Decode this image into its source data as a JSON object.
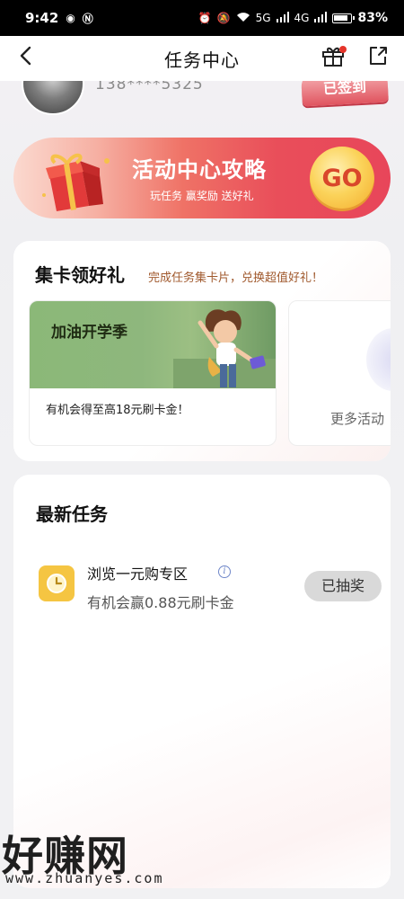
{
  "status_bar": {
    "time": "9:42",
    "network_5g": "5G",
    "network_4g": "4G",
    "battery": "83%"
  },
  "nav": {
    "title": "任务中心",
    "back_icon": "chevron-left-icon",
    "gift_icon": "gift-icon",
    "share_icon": "share-icon",
    "accent_dot_color": "#e5342a"
  },
  "user": {
    "phone_masked": "138****5325",
    "signed_badge": "已签到"
  },
  "strategy_banner": {
    "title": "活动中心攻略",
    "subtitle": "玩任务 赢奖励 送好礼",
    "go_label": "GO"
  },
  "card_section": {
    "title": "集卡领好礼",
    "desc": "完成任务集卡片，兑换超值好礼！",
    "promo": {
      "image_title": "加油开学季",
      "text": "有机会得至高18元刷卡金！"
    },
    "more_label": "更多活动"
  },
  "tasks": {
    "title": "最新任务",
    "items": [
      {
        "name": "浏览一元购专区",
        "reward": "有机会赢0.88元刷卡金",
        "status": "已抽奖",
        "icon": "clock-icon"
      }
    ]
  },
  "watermark": {
    "main": "好赚网",
    "url": "www.zhuanyes.com"
  },
  "colors": {
    "banner_red": "#e94e5a",
    "go_yellow": "#fbd35a",
    "desc_brown": "#a0592d",
    "task_icon_yellow": "#f5c542"
  }
}
